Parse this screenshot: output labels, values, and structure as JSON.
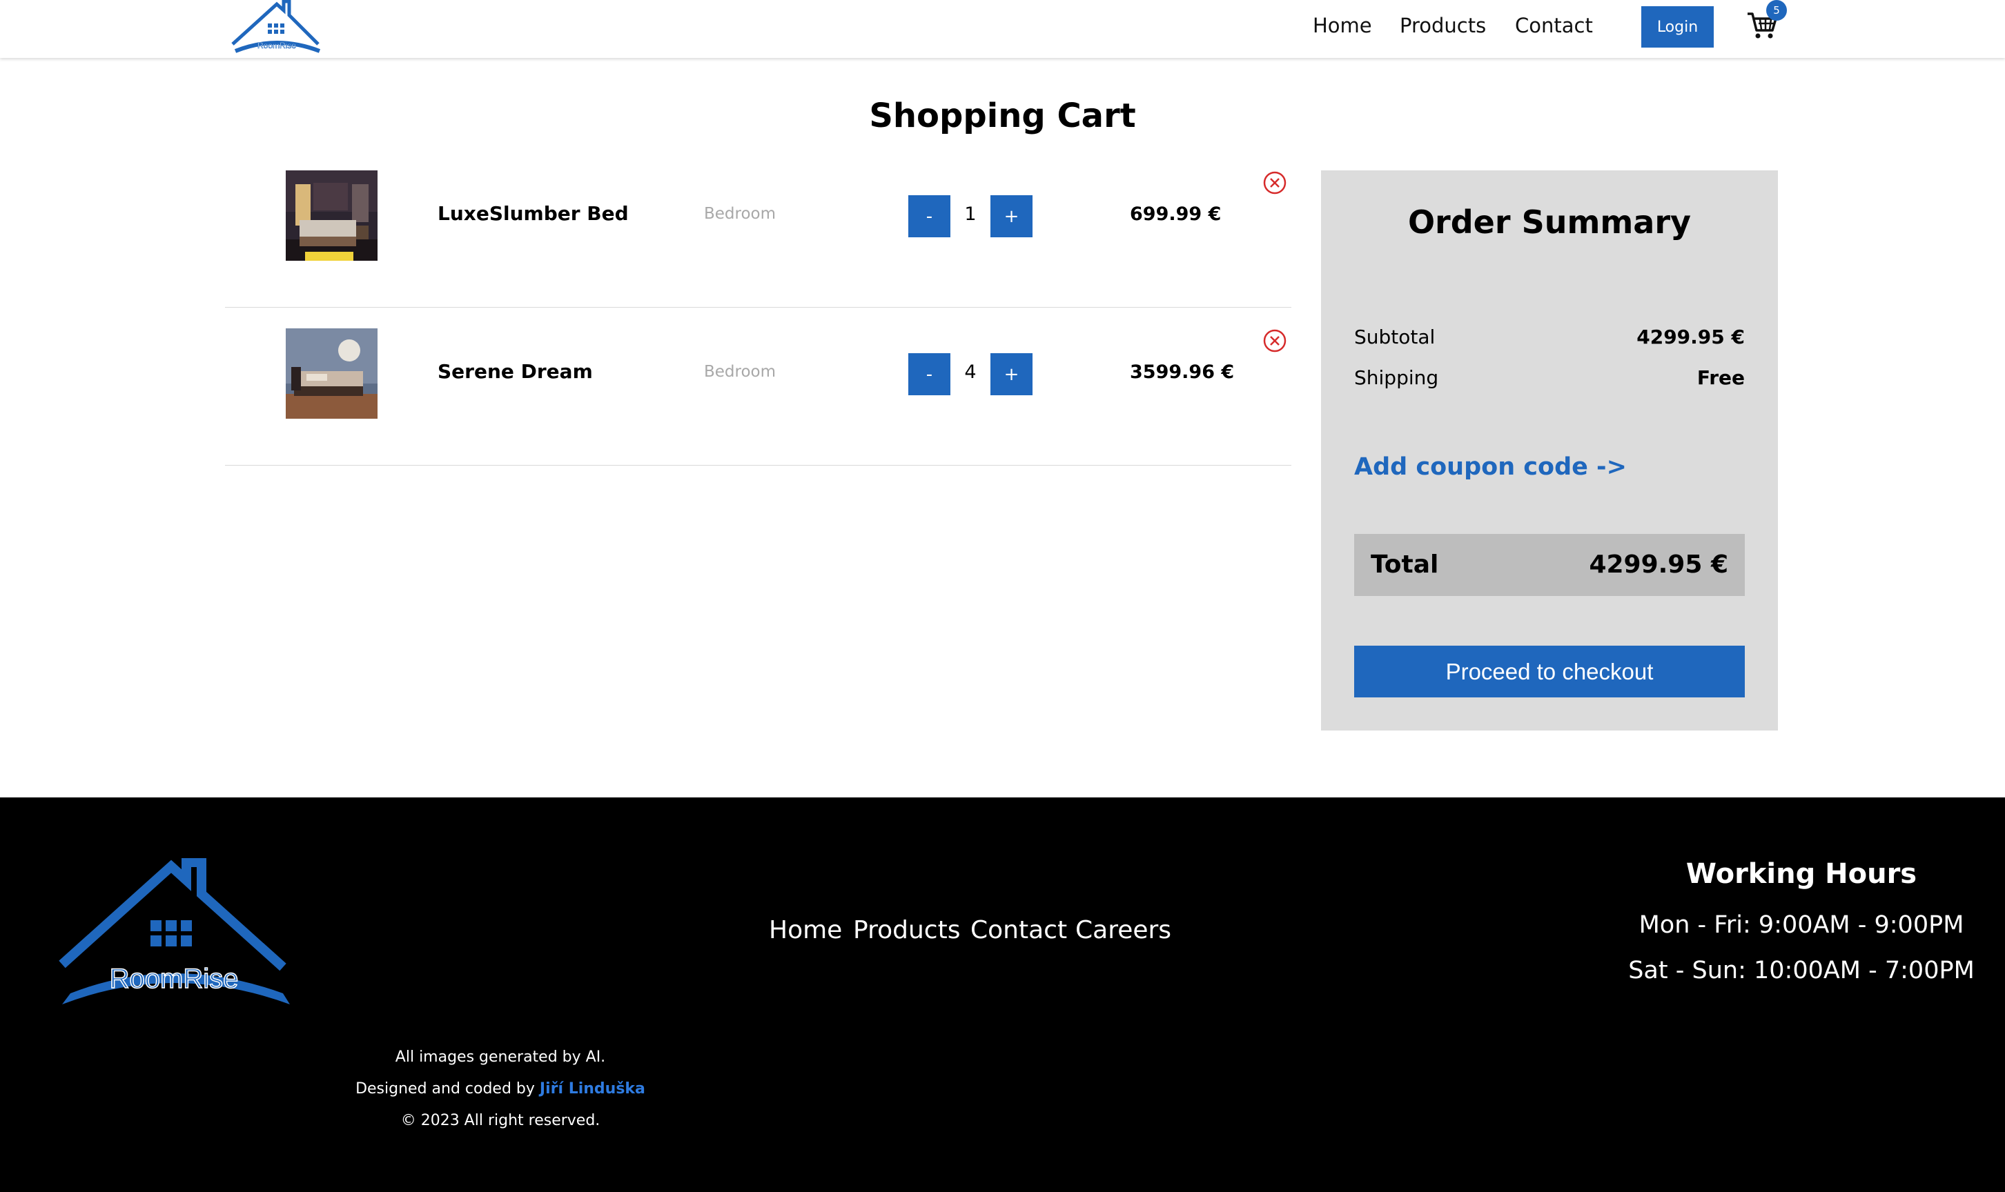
{
  "header": {
    "logo_text": "RoomRise",
    "nav": [
      "Home",
      "Products",
      "Contact"
    ],
    "login_label": "Login",
    "cart_icon": "cart-icon",
    "cart_count": "5"
  },
  "cart": {
    "title": "Shopping Cart",
    "items": [
      {
        "name": "LuxeSlumber Bed",
        "category": "Bedroom",
        "quantity": "1",
        "price": "699.99 €",
        "minus": "-",
        "plus": "+"
      },
      {
        "name": "Serene Dream",
        "category": "Bedroom",
        "quantity": "4",
        "price": "3599.96 €",
        "minus": "-",
        "plus": "+"
      }
    ],
    "remove_icon": "remove-circle-icon"
  },
  "summary": {
    "title": "Order Summary",
    "subtotal_label": "Subtotal",
    "subtotal_value": "4299.95 €",
    "shipping_label": "Shipping",
    "shipping_value": "Free",
    "coupon_label": "Add coupon code ->",
    "total_label": "Total",
    "total_value": "4299.95 €",
    "checkout_label": "Proceed to checkout"
  },
  "footer": {
    "logo_text": "RoomRise",
    "nav": [
      "Home",
      "Products",
      "Contact",
      "Careers"
    ],
    "hours_title": "Working Hours",
    "hours_weekdays": "Mon - Fri: 9:00AM - 9:00PM",
    "hours_weekend": "Sat - Sun: 10:00AM - 7:00PM",
    "credit_ai": "All images generated by AI.",
    "credit_design": "Designed and coded by",
    "credit_author": "Jiří Linduška",
    "credit_copyright": "© 2023 All right reserved."
  },
  "colors": {
    "accent": "#1f67bd",
    "summary_bg": "#dcdcdc",
    "total_bg": "#bdbdbd",
    "footer_bg": "#000000",
    "remove": "#d62b2b"
  }
}
